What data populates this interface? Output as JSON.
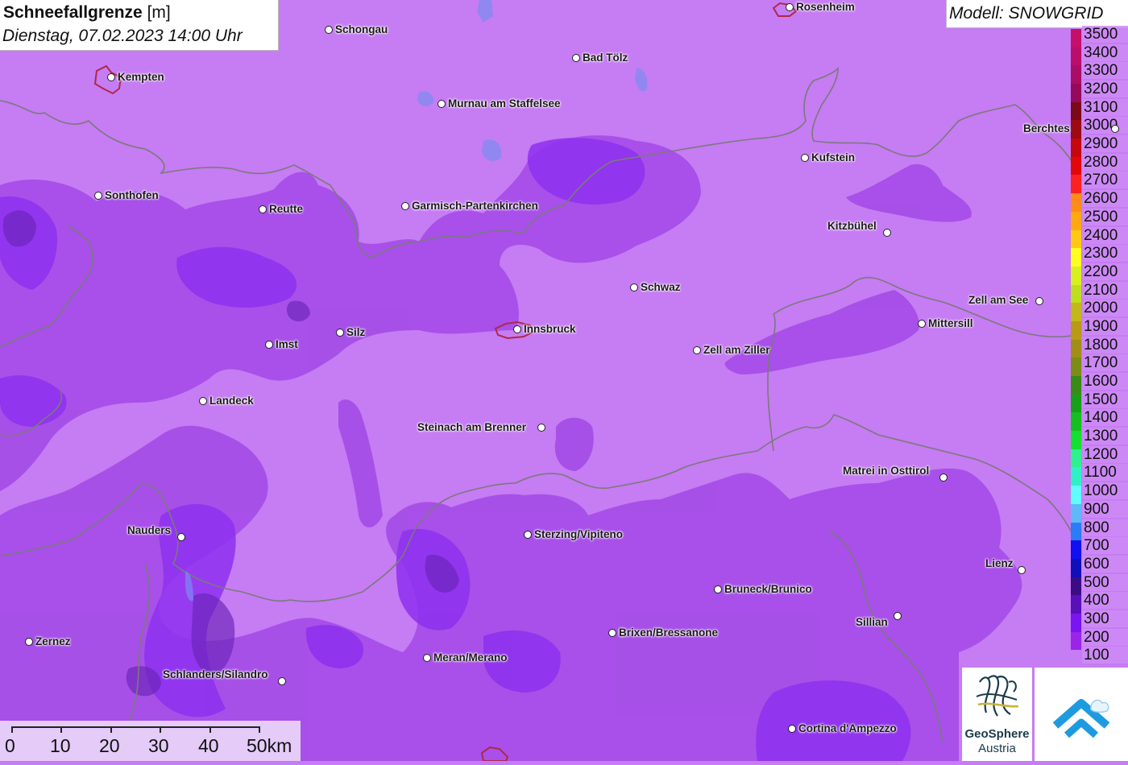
{
  "header": {
    "title_bold": "Schneefallgrenze",
    "title_unit": "[m]",
    "datetime": "Dienstag, 07.02.2023 14:00 Uhr"
  },
  "model": {
    "label": "Modell: SNOWGRID"
  },
  "legend": {
    "items": [
      {
        "label": "3500",
        "color": "#c4106a"
      },
      {
        "label": "3400",
        "color": "#b90e6a"
      },
      {
        "label": "3300",
        "color": "#a90d66"
      },
      {
        "label": "3200",
        "color": "#960a5c"
      },
      {
        "label": "3100",
        "color": "#7a0a18"
      },
      {
        "label": "3000",
        "color": "#9c0a12"
      },
      {
        "label": "2900",
        "color": "#c4080e"
      },
      {
        "label": "2800",
        "color": "#e30808"
      },
      {
        "label": "2700",
        "color": "#ff2020"
      },
      {
        "label": "2600",
        "color": "#ff8c1a"
      },
      {
        "label": "2500",
        "color": "#ffa814"
      },
      {
        "label": "2400",
        "color": "#ffc814"
      },
      {
        "label": "2300",
        "color": "#ffff20"
      },
      {
        "label": "2200",
        "color": "#d8f020"
      },
      {
        "label": "2100",
        "color": "#bede20"
      },
      {
        "label": "2000",
        "color": "#c2b81a"
      },
      {
        "label": "1900",
        "color": "#b89a16"
      },
      {
        "label": "1800",
        "color": "#a08e16"
      },
      {
        "label": "1700",
        "color": "#7c8c16"
      },
      {
        "label": "1600",
        "color": "#3a8a16"
      },
      {
        "label": "1500",
        "color": "#18a018"
      },
      {
        "label": "1400",
        "color": "#14c020"
      },
      {
        "label": "1300",
        "color": "#14e030"
      },
      {
        "label": "1200",
        "color": "#30f090"
      },
      {
        "label": "1100",
        "color": "#30f0c8"
      },
      {
        "label": "1000",
        "color": "#60ffff"
      },
      {
        "label": "900",
        "color": "#60b8f8"
      },
      {
        "label": "800",
        "color": "#2c7cf8"
      },
      {
        "label": "700",
        "color": "#1010f0"
      },
      {
        "label": "600",
        "color": "#1010b8"
      },
      {
        "label": "500",
        "color": "#3c0c84"
      },
      {
        "label": "400",
        "color": "#5a10b8"
      },
      {
        "label": "300",
        "color": "#7a14f0"
      },
      {
        "label": "200",
        "color": "#9a24e8"
      },
      {
        "label": "100",
        "color": "#c67cf3"
      }
    ]
  },
  "colors": {
    "base": "#c67cf3",
    "level_200": "#a64ee8",
    "level_300": "#8e30ee",
    "level_400": "#6a24b8",
    "borders": "#7a7a7a",
    "city_outline": "#b0284a"
  },
  "cities": [
    {
      "name": "Rosenheim",
      "label_side": "right"
    },
    {
      "name": "Schongau",
      "label_side": "right"
    },
    {
      "name": "Kempten",
      "label_side": "right"
    },
    {
      "name": "Bad Tölz",
      "label_side": "right"
    },
    {
      "name": "Murnau am Staffelsee",
      "label_side": "right"
    },
    {
      "name": "Berchtes",
      "label_side": "left"
    },
    {
      "name": "Kufstein",
      "label_side": "right"
    },
    {
      "name": "Sonthofen",
      "label_side": "right"
    },
    {
      "name": "Reutte",
      "label_side": "right"
    },
    {
      "name": "Garmisch-Partenkirchen",
      "label_side": "right"
    },
    {
      "name": "Kitzbühel",
      "label_side": "left"
    },
    {
      "name": "Schwaz",
      "label_side": "right"
    },
    {
      "name": "Zell am See",
      "label_side": "left"
    },
    {
      "name": "Innsbruck",
      "label_side": "right"
    },
    {
      "name": "Silz",
      "label_side": "right"
    },
    {
      "name": "Imst",
      "label_side": "right"
    },
    {
      "name": "Mittersill",
      "label_side": "right"
    },
    {
      "name": "Zell am Ziller",
      "label_side": "right"
    },
    {
      "name": "Landeck",
      "label_side": "right"
    },
    {
      "name": "Steinach am Brenner",
      "label_side": "left"
    },
    {
      "name": "Matrei in Osttirol",
      "label_side": "left"
    },
    {
      "name": "Nauders",
      "label_side": "left"
    },
    {
      "name": "Sterzing/Vipiteno",
      "label_side": "right"
    },
    {
      "name": "Lienz",
      "label_side": "left"
    },
    {
      "name": "Bruneck/Brunico",
      "label_side": "right"
    },
    {
      "name": "Sillian",
      "label_side": "left"
    },
    {
      "name": "Brixen/Bressanone",
      "label_side": "right"
    },
    {
      "name": "Zernez",
      "label_side": "right"
    },
    {
      "name": "Meran/Merano",
      "label_side": "right"
    },
    {
      "name": "Schlanders/Silandro",
      "label_side": "left"
    },
    {
      "name": "Cortina d'Ampezzo",
      "label_side": "right"
    }
  ],
  "scale": {
    "labels": [
      "0",
      "10",
      "20",
      "30",
      "40",
      "50km"
    ]
  },
  "logos": {
    "geosphere_line1": "GeoSphere",
    "geosphere_line2": "Austria"
  }
}
